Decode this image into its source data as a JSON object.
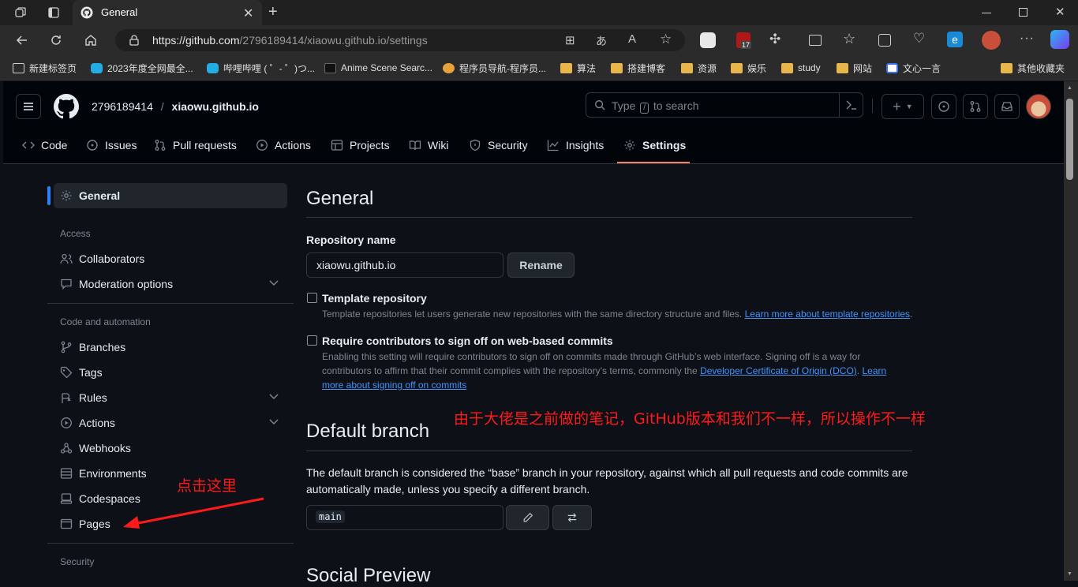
{
  "browser": {
    "tab_title": "General",
    "url_host": "https://github.com",
    "url_path": "/2796189414/xiaowu.github.io/settings",
    "extension_badge": "17",
    "bookmarks": [
      {
        "label": "新建标签页",
        "icon": "page-icon"
      },
      {
        "label": "2023年度全网最全...",
        "icon": "bilibili-icon"
      },
      {
        "label": "哔哩哔哩 ( ゜- ゜)つ...",
        "icon": "bilibili-icon"
      },
      {
        "label": "Anime Scene Searc...",
        "icon": "tracemoe-icon"
      },
      {
        "label": "程序员导航-程序员...",
        "icon": "rocket-icon"
      },
      {
        "label": "算法",
        "icon": "folder-icon"
      },
      {
        "label": "搭建博客",
        "icon": "folder-icon"
      },
      {
        "label": "资源",
        "icon": "folder-icon"
      },
      {
        "label": "娱乐",
        "icon": "folder-icon"
      },
      {
        "label": "study",
        "icon": "folder-icon"
      },
      {
        "label": "网站",
        "icon": "folder-icon"
      },
      {
        "label": "文心一言",
        "icon": "wenxin-icon"
      }
    ],
    "other_bookmarks": "其他收藏夹"
  },
  "github": {
    "owner": "2796189414",
    "separator": "/",
    "repo": "xiaowu.github.io",
    "search_prefix": "Type",
    "search_key": "/",
    "search_suffix": "to search",
    "nav": [
      "Code",
      "Issues",
      "Pull requests",
      "Actions",
      "Projects",
      "Wiki",
      "Security",
      "Insights",
      "Settings"
    ]
  },
  "sidebar": {
    "general": "General",
    "access_heading": "Access",
    "collaborators": "Collaborators",
    "moderation": "Moderation options",
    "code_heading": "Code and automation",
    "branches": "Branches",
    "tags": "Tags",
    "rules": "Rules",
    "actions": "Actions",
    "webhooks": "Webhooks",
    "environments": "Environments",
    "codespaces": "Codespaces",
    "pages": "Pages",
    "security_heading": "Security"
  },
  "main": {
    "title": "General",
    "repo_name_label": "Repository name",
    "repo_name_value": "xiaowu.github.io",
    "rename_button": "Rename",
    "template_title": "Template repository",
    "template_desc": "Template repositories let users generate new repositories with the same directory structure and files.",
    "template_link": "Learn more about template repositories",
    "signoff_title": "Require contributors to sign off on web-based commits",
    "signoff_line1": "Enabling this setting will require contributors to sign off on commits made through GitHub’s web interface. Signing off is a way for",
    "signoff_line2": "contributors to affirm that their commit complies with the repository’s terms, commonly the",
    "signoff_link1": "Developer Certificate of Origin (DCO)",
    "signoff_link2a": "Learn",
    "signoff_link2b": "more about signing off on commits",
    "default_branch_title": "Default branch",
    "default_branch_line1": "The default branch is considered the “base” branch in your repository, against which all pull requests and code commits are",
    "default_branch_line2": "automatically made, unless you specify a different branch.",
    "branch_value": "main",
    "social_preview_title": "Social Preview"
  },
  "annotations": {
    "note_top": "由于大佬是之前做的笔记，GitHub版本和我们不一样，所以操作不一样",
    "note_click": "点击这里",
    "color": "#ff1a1a"
  }
}
